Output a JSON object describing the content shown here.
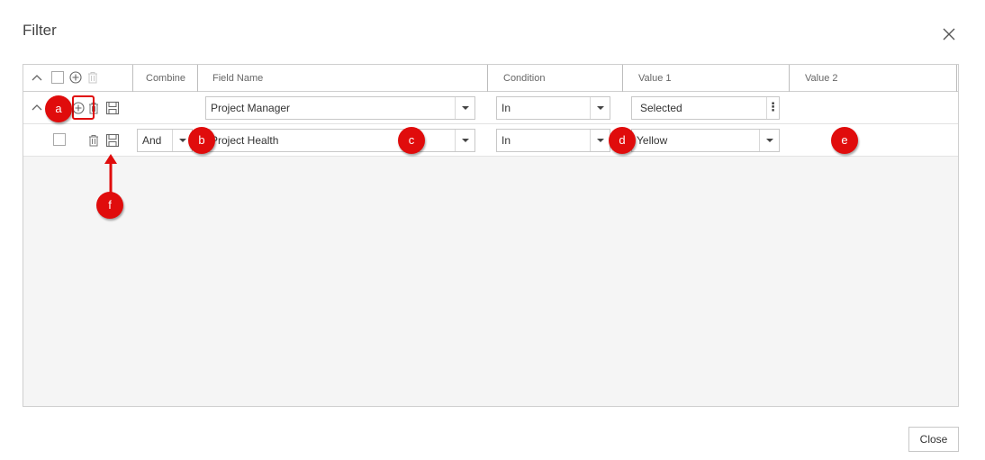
{
  "dialog": {
    "title": "Filter",
    "close_button_label": "Close"
  },
  "grid": {
    "columns": [
      "Combine",
      "Field Name",
      "Condition",
      "Value 1",
      "Value 2"
    ],
    "rows": [
      {
        "combine": "",
        "field_name": "Project Manager",
        "condition": "In",
        "value1": "Selected",
        "value2": ""
      },
      {
        "combine": "And",
        "field_name": "Project Health",
        "condition": "In",
        "value1": "Yellow",
        "value2": ""
      }
    ]
  },
  "callouts": [
    "a",
    "b",
    "c",
    "d",
    "e",
    "f"
  ],
  "colors": {
    "callout": "#e00c0c",
    "border": "#cfcfcf",
    "grid_background": "#f5f5f5"
  },
  "icons": [
    "collapse-icon",
    "add-icon",
    "delete-icon",
    "save-icon",
    "close-icon",
    "chevron-down-icon",
    "more-vertical-icon"
  ]
}
